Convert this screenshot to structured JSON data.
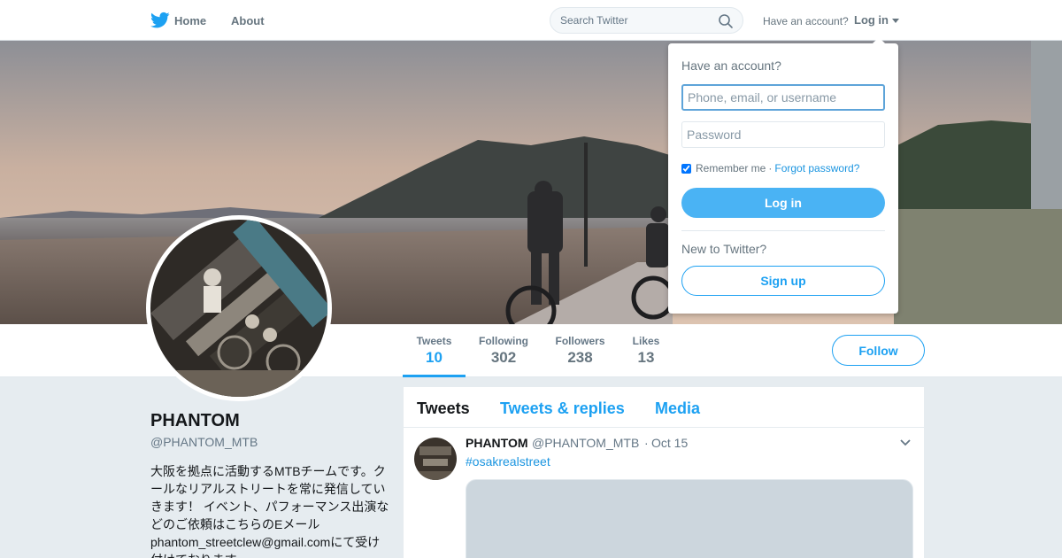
{
  "nav": {
    "home": "Home",
    "about": "About",
    "search_placeholder": "Search Twitter",
    "have_account": "Have an account?",
    "login": "Log in"
  },
  "profile": {
    "name": "PHANTOM",
    "handle": "@PHANTOM_MTB",
    "bio": "大阪を拠点に活動するMTBチームです。クールなリアルストリートを常に発信していきます！ イベント、パフォーマンス出演などのご依頼はこちらのEメールphantom_streetclew@gmail.comにて受け付けております。",
    "follow_label": "Follow"
  },
  "stats": [
    {
      "label": "Tweets",
      "value": "10"
    },
    {
      "label": "Following",
      "value": "302"
    },
    {
      "label": "Followers",
      "value": "238"
    },
    {
      "label": "Likes",
      "value": "13"
    }
  ],
  "timeline": {
    "tabs": [
      "Tweets",
      "Tweets & replies",
      "Media"
    ],
    "tweet": {
      "name": "PHANTOM",
      "handle": "@PHANTOM_MTB",
      "separator": "·",
      "time": "Oct 15",
      "text": "#osakrealstreet"
    }
  },
  "login_dropdown": {
    "title": "Have an account?",
    "username_placeholder": "Phone, email, or username",
    "password_placeholder": "Password",
    "remember_me": "Remember me",
    "separator": "·",
    "forgot_password": "Forgot password?",
    "login_button": "Log in",
    "new_to_twitter": "New to Twitter?",
    "signup_button": "Sign up"
  },
  "colors": {
    "brand_blue": "#1da1f2",
    "link_blue": "#1b95e0",
    "login_button": "#4ab3f4",
    "page_background": "#e6ecf0"
  }
}
